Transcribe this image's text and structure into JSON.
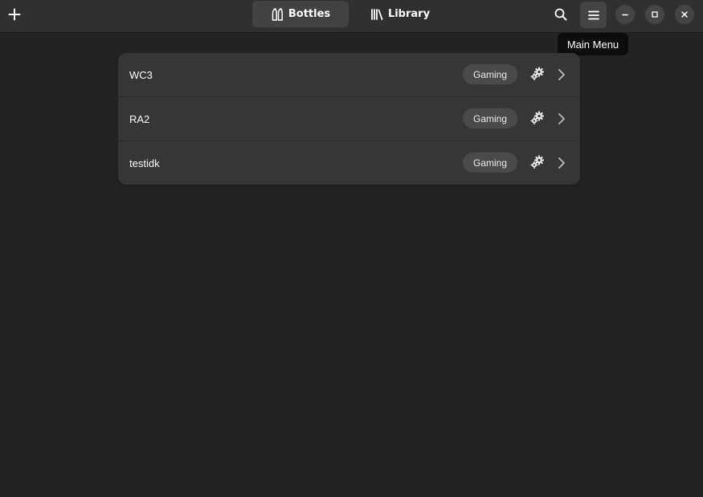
{
  "header": {
    "add_icon": "plus-icon",
    "tabs": [
      {
        "label": "Bottles",
        "icon": "bottles-icon",
        "active": true
      },
      {
        "label": "Library",
        "icon": "library-icon",
        "active": false
      }
    ],
    "search_icon": "search-icon",
    "menu_icon": "hamburger-menu-icon",
    "window_controls": [
      "minimize-icon",
      "maximize-icon",
      "close-icon"
    ]
  },
  "tooltip": {
    "text": "Main Menu"
  },
  "bottles": [
    {
      "name": "WC3",
      "environment": "Gaming"
    },
    {
      "name": "RA2",
      "environment": "Gaming"
    },
    {
      "name": "testidk",
      "environment": "Gaming"
    }
  ],
  "colors": {
    "window_bg": "#242424",
    "headerbar_bg": "#303030",
    "list_bg": "#363636",
    "badge_bg": "#4a4a4a",
    "tooltip_bg": "#0d0d0d"
  }
}
